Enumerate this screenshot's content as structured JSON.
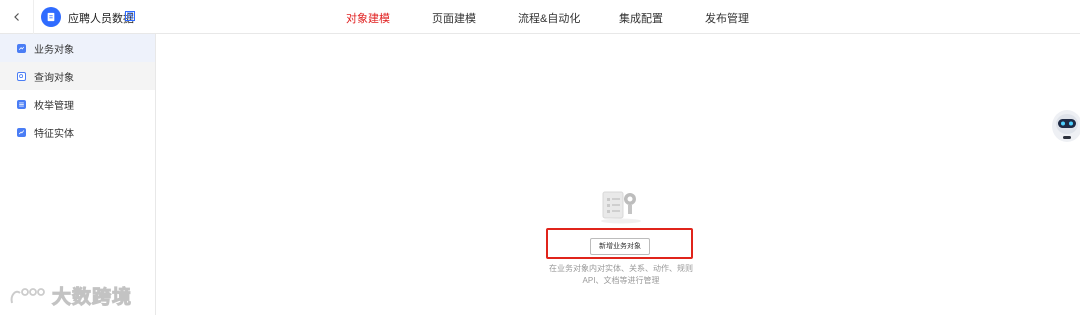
{
  "header": {
    "app_title": "应聘人员数据",
    "app_badge": "西",
    "nav": [
      {
        "label": "对象建模",
        "active": true
      },
      {
        "label": "页面建模",
        "active": false
      },
      {
        "label": "流程&自动化",
        "active": false
      },
      {
        "label": "集成配置",
        "active": false
      },
      {
        "label": "发布管理",
        "active": false
      }
    ]
  },
  "sidebar": {
    "items": [
      {
        "label": "业务对象",
        "icon": "business-object-icon",
        "selected": true
      },
      {
        "label": "查询对象",
        "icon": "query-object-icon",
        "hovered": true
      },
      {
        "label": "枚举管理",
        "icon": "enum-icon"
      },
      {
        "label": "特征实体",
        "icon": "feature-entity-icon"
      }
    ]
  },
  "main": {
    "button_label": "新增业务对象",
    "hint_line1": "在业务对象内对实体、关系、动作、规则",
    "hint_line2": "API、文档等进行管理"
  },
  "watermark": {
    "text": "大数跨境"
  },
  "colors": {
    "accent": "#2f6bff",
    "active_nav": "#e02020",
    "highlight_box": "#e0241b",
    "sidebar_selected": "#eef2fb"
  }
}
